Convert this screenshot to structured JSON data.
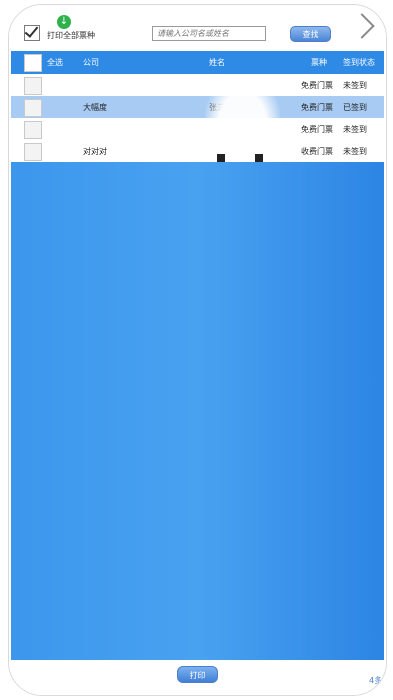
{
  "toolbar": {
    "print_all_label": "打印全部票种",
    "search_placeholder": "请输入公司名或姓名",
    "search_button": "查找"
  },
  "table": {
    "headers": {
      "select_all": "全选",
      "company": "公司",
      "name": "姓名",
      "ticket_type": "票种",
      "checkin_status": "签到状态"
    },
    "rows": [
      {
        "company": "",
        "name": "",
        "ticket_type": "免费门票",
        "status": "未签到",
        "selected": false
      },
      {
        "company": "大幅度",
        "name": "张三",
        "ticket_type": "免费门票",
        "status": "已签到",
        "selected": true
      },
      {
        "company": "",
        "name": "",
        "ticket_type": "免费门票",
        "status": "未签到",
        "selected": false
      },
      {
        "company": "对对对",
        "name": "",
        "ticket_type": "收费门票",
        "status": "未签到",
        "selected": false
      }
    ]
  },
  "footer": {
    "print_button": "打印",
    "page_indicator": "4多"
  },
  "colors": {
    "header_blue": "#2f8ae6",
    "selected_row": "#a7cbf3",
    "body_blue": "#49a2f0"
  }
}
